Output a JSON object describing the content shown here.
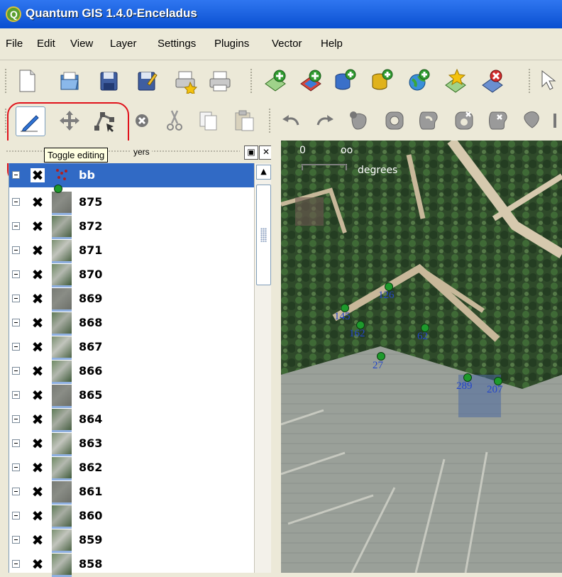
{
  "window": {
    "title": "Quantum GIS 1.4.0-Enceladus"
  },
  "menu": [
    "File",
    "Edit",
    "View",
    "Layer",
    "Settings",
    "Plugins",
    "Vector",
    "Help"
  ],
  "toolbar_file": [
    "new-project-icon",
    "open-project-icon",
    "save-project-icon",
    "save-as-icon",
    "print-composer-icon",
    "print-icon",
    "add-vector-layer-icon",
    "add-raster-layer-icon",
    "add-postgis-layer-icon",
    "add-spatialite-layer-icon",
    "add-wms-layer-icon",
    "new-vector-layer-icon",
    "remove-layer-icon"
  ],
  "toolbar_digitizing": [
    "toggle-editing-icon",
    "move-feature-icon",
    "node-tool-icon",
    "delete-selected-icon",
    "cut-icon",
    "copy-icon",
    "paste-icon",
    "undo-icon",
    "redo-icon",
    "simplify-feature-icon",
    "add-ring-icon",
    "add-part-icon",
    "delete-ring-icon",
    "delete-part-icon"
  ],
  "legend": {
    "header_label": "yers",
    "tooltip": "Toggle editing",
    "layers": [
      {
        "name": "bb",
        "selected": true,
        "type": "point"
      },
      {
        "name": "875"
      },
      {
        "name": "872"
      },
      {
        "name": "871"
      },
      {
        "name": "870"
      },
      {
        "name": "869"
      },
      {
        "name": "868"
      },
      {
        "name": "867"
      },
      {
        "name": "866"
      },
      {
        "name": "865"
      },
      {
        "name": "864"
      },
      {
        "name": "863"
      },
      {
        "name": "862"
      },
      {
        "name": "861"
      },
      {
        "name": "860"
      },
      {
        "name": "859"
      },
      {
        "name": "858"
      }
    ]
  },
  "map": {
    "scale_zero": "0",
    "scale_value": "oo",
    "scale_unit": "degrees",
    "points": [
      "126",
      "145",
      "162",
      "62",
      "27",
      "289",
      "207"
    ],
    "point_color": "#1e9a2c",
    "label_color": "#2446c8"
  },
  "colors": {
    "title_bar": "#0a4fd0",
    "highlight": "#e0121b",
    "selection": "#316ac5"
  }
}
